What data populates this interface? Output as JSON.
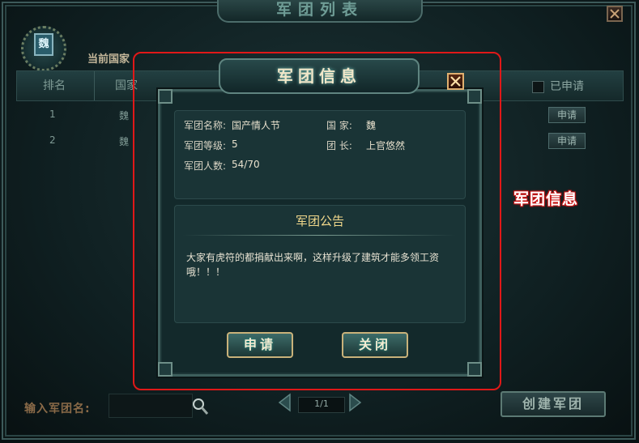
{
  "window": {
    "title": "军团列表"
  },
  "country": {
    "emblem": "魏",
    "label": "当前国家"
  },
  "table": {
    "headers": [
      "排名",
      "国家"
    ],
    "applied_filter_label": "已申请",
    "rows": [
      {
        "rank": "1",
        "country": "魏",
        "action": "申请"
      },
      {
        "rank": "2",
        "country": "魏",
        "action": "申请"
      }
    ]
  },
  "search": {
    "label": "输入军团名:"
  },
  "pager": {
    "page": "1/1"
  },
  "create_button": "创建军团",
  "dialog": {
    "title": "军团信息",
    "info": {
      "name_label": "军团名称:",
      "name_value": "国产情人节",
      "country_label": "国  家:",
      "country_value": "魏",
      "level_label": "军团等级:",
      "level_value": "5",
      "leader_label": "团  长:",
      "leader_value": "上官悠然",
      "members_label": "军团人数:",
      "members_value": "54/70"
    },
    "notice_title": "军团公告",
    "notice_text": "大家有虎符的都捐献出来啊，这样升级了建筑才能多领工资哦！！！",
    "apply_button": "申请",
    "close_button": "关闭"
  },
  "annotation": "军团信息",
  "colors": {
    "highlight": "#e01818",
    "accent_gold": "#f2d98c",
    "frame": "#3e5f5d"
  }
}
